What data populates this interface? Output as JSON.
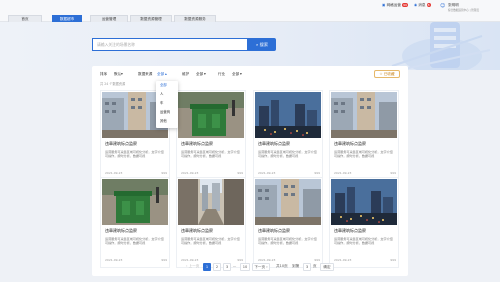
{
  "tabs": [
    {
      "label": "首页"
    },
    {
      "label": "数据超市"
    },
    {
      "label": "运营管理"
    },
    {
      "label": "数据资源管理"
    },
    {
      "label": "数据资源服务"
    }
  ],
  "header": {
    "msg_label": "网格运营",
    "msg_count": "99",
    "notice_label": "消息",
    "notice_count": "8",
    "user_name": "张明明",
    "user_org": "综合数据运营中心 | 管理员"
  },
  "search": {
    "placeholder": "请输入关注的场景名称",
    "button": "搜索"
  },
  "filters": [
    {
      "label": "排序",
      "value": "默认"
    },
    {
      "label": "数据来源",
      "value": "全部"
    },
    {
      "label": "维护",
      "value": "全部"
    },
    {
      "label": "行业",
      "value": "全部"
    }
  ],
  "count": "共 24 个数据资源",
  "sort_button": "已收藏",
  "dropdown": [
    "全部",
    "人",
    "车",
    "运营商",
    "其他"
  ],
  "cards": [
    {
      "title": "违章建筑标点监察",
      "desc1": "运营服务可采集区域可视化分析，文字介绍",
      "desc2": "可操作，按时分析，数据可视",
      "date": "2021-09-23",
      "views": "999"
    },
    {
      "title": "违章建筑标点监察",
      "desc1": "运营服务可采集区域可视化分析，文字介绍",
      "desc2": "可操作，按时分析，数据可视",
      "date": "2021-09-23",
      "views": "999"
    },
    {
      "title": "违章建筑标点监察",
      "desc1": "运营服务可采集区域可视化分析，文字介绍",
      "desc2": "可操作，按时分析，数据可视",
      "date": "2021-09-23",
      "views": "999"
    },
    {
      "title": "违章建筑标点监察",
      "desc1": "运营服务可采集区域可视化分析，文字介绍",
      "desc2": "可操作，按时分析，数据可视",
      "date": "2021-09-23",
      "views": "999"
    },
    {
      "title": "违章建筑标点监察",
      "desc1": "运营服务可采集区域可视化分析，文字介绍",
      "desc2": "可操作，按时分析，数据可视",
      "date": "2021-09-23",
      "views": "999"
    },
    {
      "title": "违章建筑标点监察",
      "desc1": "运营服务可采集区域可视化分析，文字介绍",
      "desc2": "可操作，按时分析，数据可视",
      "date": "2021-09-23",
      "views": "999"
    },
    {
      "title": "违章建筑标点监察",
      "desc1": "运营服务可采集区域可视化分析，文字介绍",
      "desc2": "可操作，按时分析，数据可视",
      "date": "2021-09-23",
      "views": "999"
    },
    {
      "title": "违章建筑标点监察",
      "desc1": "运营服务可采集区域可视化分析，文字介绍",
      "desc2": "可操作，按时分析，数据可视",
      "date": "2021-09-23",
      "views": "999"
    }
  ],
  "pager": {
    "prev": "上一页",
    "pages": [
      "1",
      "2",
      "3"
    ],
    "ellipsis": "...",
    "last": "10",
    "next": "下一页",
    "total": "共10页",
    "goto": "到第",
    "goto_value": "3",
    "page_unit": "页",
    "confirm": "确定"
  },
  "colors": {
    "accent": "#2d6fd6",
    "collect": "#e6b86a"
  }
}
